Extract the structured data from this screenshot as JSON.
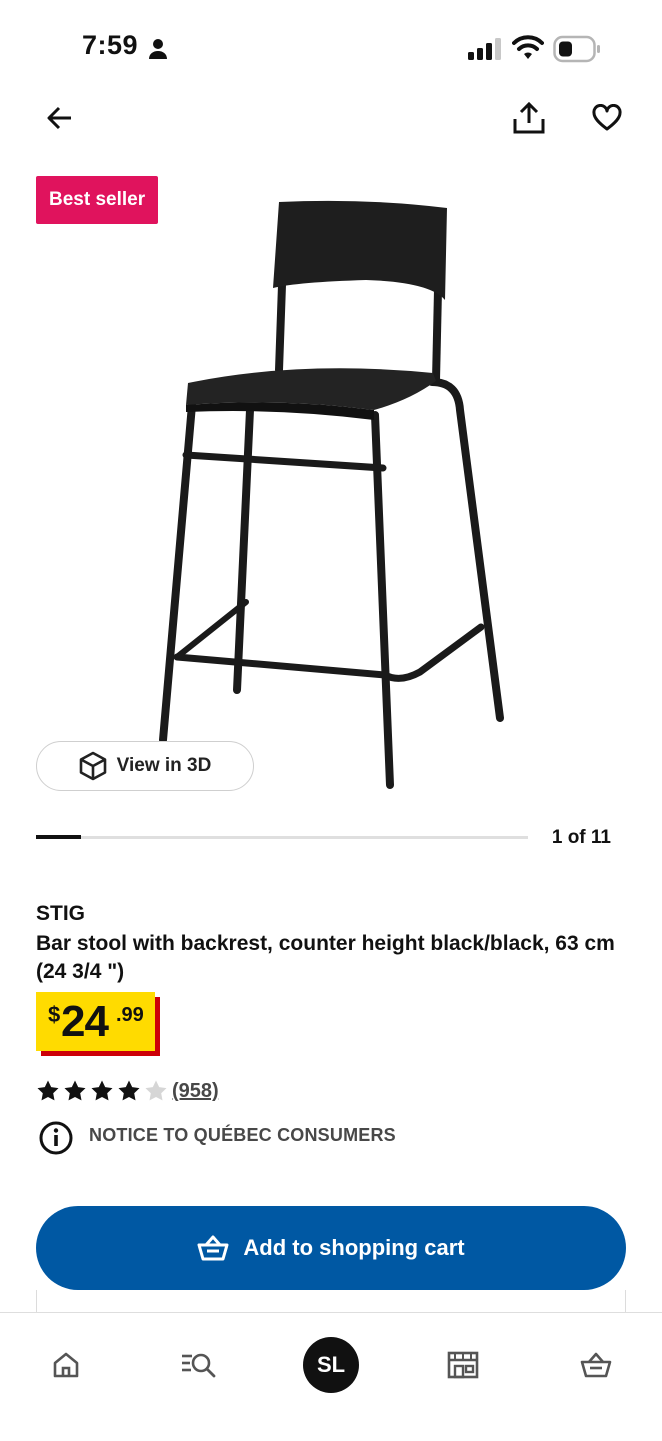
{
  "status_bar": {
    "time": "7:59"
  },
  "badge": {
    "label": "Best seller"
  },
  "view_3d": {
    "label": "View in 3D"
  },
  "carousel": {
    "counter": "1 of 11",
    "progress": 0.0915
  },
  "product": {
    "name": "STIG",
    "description": "Bar stool with backrest, counter height black/black, 63 cm (24 3/4 \")",
    "price": {
      "currency": "$",
      "integer": "24",
      "decimal": ".99"
    },
    "rating": {
      "stars": 4,
      "max": 5,
      "reviews": "(958)"
    },
    "notice": "NOTICE TO QUÉBEC CONSUMERS"
  },
  "cart_button": {
    "label": "Add to shopping cart"
  },
  "bottom_nav": {
    "profile_initials": "SL"
  },
  "colors": {
    "badge": "#e0135d",
    "price_yellow": "#ffdb00",
    "price_red": "#cc0008",
    "cart_blue": "#0058a3"
  },
  "icons": [
    "person-icon",
    "signal-icon",
    "wifi-icon",
    "battery-icon",
    "back-arrow-icon",
    "share-icon",
    "heart-icon",
    "cube-icon",
    "info-icon",
    "basket-icon",
    "home-icon",
    "search-icon",
    "store-icon"
  ]
}
